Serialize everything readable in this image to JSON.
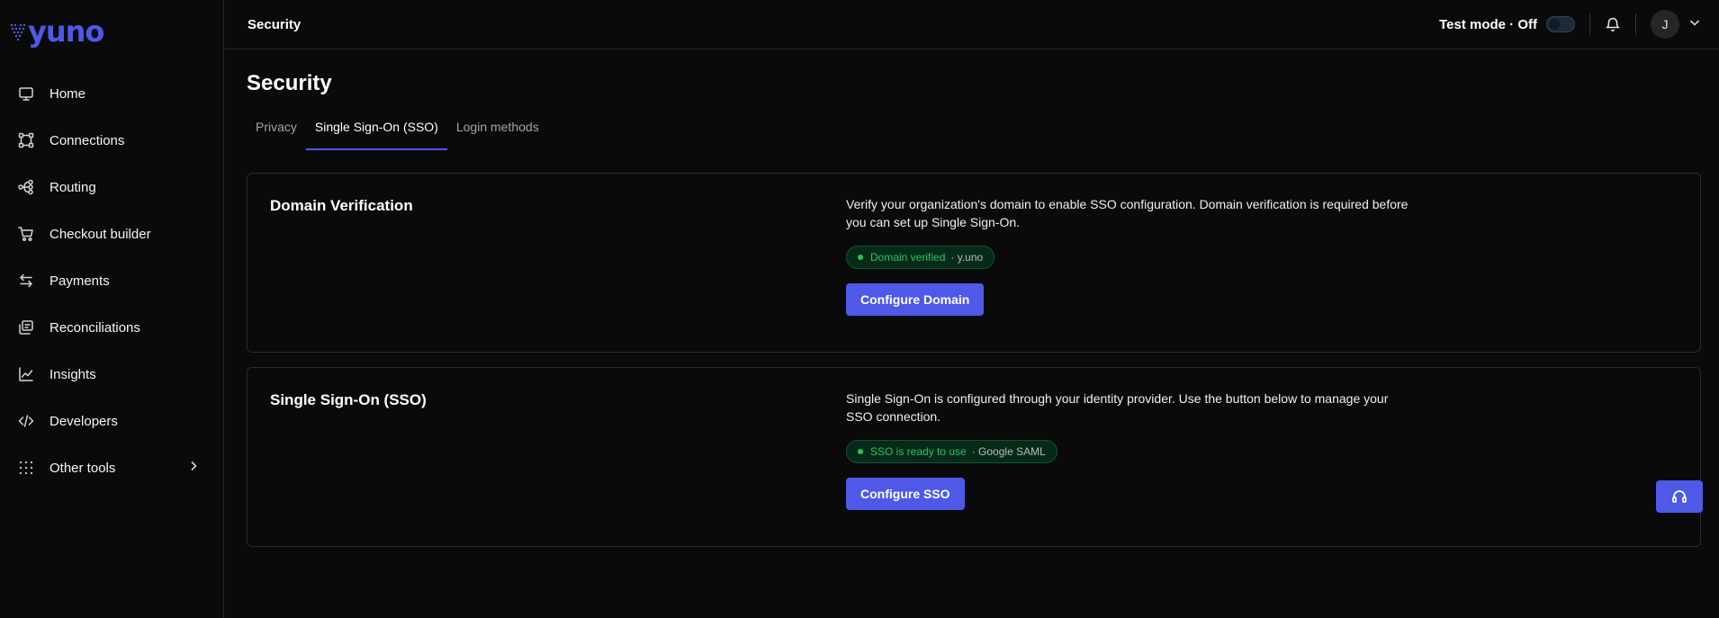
{
  "brand": {
    "name": "yuno",
    "accent": "#4e59e8"
  },
  "sidebar": {
    "items": [
      {
        "label": "Home",
        "icon": "monitor-icon"
      },
      {
        "label": "Connections",
        "icon": "connections-icon"
      },
      {
        "label": "Routing",
        "icon": "routing-icon"
      },
      {
        "label": "Checkout builder",
        "icon": "cart-icon"
      },
      {
        "label": "Payments",
        "icon": "arrows-icon"
      },
      {
        "label": "Reconciliations",
        "icon": "reconcile-icon"
      },
      {
        "label": "Insights",
        "icon": "chart-icon"
      },
      {
        "label": "Developers",
        "icon": "code-icon"
      },
      {
        "label": "Other tools",
        "icon": "grid-dots-icon",
        "has_children": true
      }
    ]
  },
  "topbar": {
    "title": "Security",
    "test_mode_label": "Test mode · Off",
    "avatar_initial": "J"
  },
  "page": {
    "title": "Security",
    "tabs": [
      {
        "label": "Privacy",
        "active": false
      },
      {
        "label": "Single Sign-On (SSO)",
        "active": true
      },
      {
        "label": "Login methods",
        "active": false
      }
    ]
  },
  "cards": {
    "domain": {
      "title": "Domain Verification",
      "description": "Verify your organization's domain to enable SSO configuration. Domain verification is required before you can set up Single Sign-On.",
      "badge_status": "Domain verified",
      "badge_detail": "· y.uno",
      "button_label": "Configure Domain"
    },
    "sso": {
      "title": "Single Sign-On (SSO)",
      "description": "Single Sign-On is configured through your identity provider. Use the button below to manage your SSO connection.",
      "badge_status": "SSO is ready to use",
      "badge_detail": "· Google SAML",
      "button_label": "Configure SSO"
    }
  }
}
